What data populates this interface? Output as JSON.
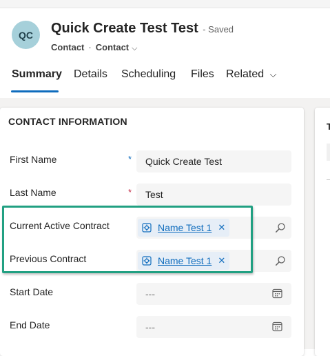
{
  "header": {
    "avatar_initials": "QC",
    "record_title": "Quick Create Test Test",
    "save_status": "- Saved",
    "entity_label": "Contact",
    "separator": "·",
    "form_selector_label": "Contact",
    "form_selector_chevron": "⌵"
  },
  "tabs": [
    {
      "label": "Summary",
      "active": true
    },
    {
      "label": "Details",
      "active": false
    },
    {
      "label": "Scheduling",
      "active": false
    },
    {
      "label": "Files",
      "active": false
    },
    {
      "label": "Related",
      "active": false,
      "chevron": "⌵"
    }
  ],
  "side_card": {
    "peek_text": "T"
  },
  "section": {
    "title": "CONTACT INFORMATION",
    "fields": {
      "first_name": {
        "label": "First Name",
        "required_mark": "*",
        "required_type": "recommended",
        "value": "Quick Create Test"
      },
      "last_name": {
        "label": "Last Name",
        "required_mark": "*",
        "required_type": "required",
        "value": "Test"
      },
      "current_active_contract": {
        "label": "Current Active Contract",
        "value": "Name Test 1",
        "remove": "✕",
        "icon": "search-icon"
      },
      "previous_contract": {
        "label": "Previous Contract",
        "value": "Name Test 1",
        "remove": "✕",
        "icon": "search-icon"
      },
      "start_date": {
        "label": "Start Date",
        "placeholder": "---",
        "icon": "calendar-icon"
      },
      "end_date": {
        "label": "End Date",
        "placeholder": "---",
        "icon": "calendar-icon"
      }
    }
  },
  "colors": {
    "accent": "#0f6cbd",
    "required": "#c4314b",
    "highlight_border": "#21a082",
    "avatar_bg": "#a6d0da",
    "lookup_tag_bg": "#e6eef7"
  }
}
